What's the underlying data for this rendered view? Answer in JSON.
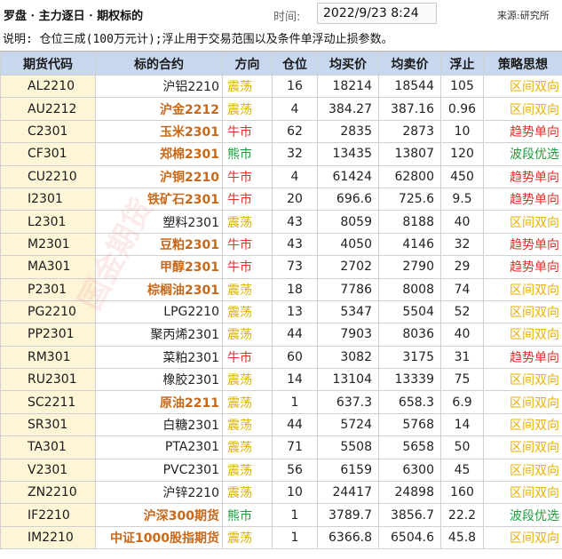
{
  "header": {
    "title": "罗盘 · 主力逐日 · 期权标的",
    "time_label": "时间:",
    "time_value": "2022/9/23 8:24",
    "source": "来源:研究所"
  },
  "note": "说明: 仓位三成(100万元计);浮止用于交易范围以及条件单浮动止损参数。",
  "watermark": "国金期货",
  "colors": {
    "header_bg": "#c7d7ee",
    "code_bg": "#fdf5d6",
    "highlight_name": "#c7691b",
    "dir_oscillation": "#d9b300",
    "dir_bull": "#e0302a",
    "dir_bear": "#1a9e3c",
    "strat_range": "#e8b000",
    "strat_trend": "#e0302a",
    "strat_wave": "#1a9e3c"
  },
  "columns": [
    "期货代码",
    "标的合约",
    "方向",
    "仓位",
    "均买价",
    "均卖价",
    "浮止",
    "策略思想"
  ],
  "rows": [
    {
      "code": "AL2210",
      "name": "沪铝2210",
      "hl": false,
      "dir": "震荡",
      "pos": "16",
      "buy": "18214",
      "sell": "18544",
      "stop": "105",
      "strat": "区间双向"
    },
    {
      "code": "AU2212",
      "name": "沪金2212",
      "hl": true,
      "dir": "震荡",
      "pos": "4",
      "buy": "384.27",
      "sell": "387.16",
      "stop": "0.96",
      "strat": "区间双向"
    },
    {
      "code": "C2301",
      "name": "玉米2301",
      "hl": true,
      "dir": "牛市",
      "pos": "62",
      "buy": "2835",
      "sell": "2873",
      "stop": "10",
      "strat": "趋势单向"
    },
    {
      "code": "CF301",
      "name": "郑棉2301",
      "hl": true,
      "dir": "熊市",
      "pos": "32",
      "buy": "13435",
      "sell": "13807",
      "stop": "120",
      "strat": "波段优选"
    },
    {
      "code": "CU2210",
      "name": "沪铜2210",
      "hl": true,
      "dir": "牛市",
      "pos": "4",
      "buy": "61424",
      "sell": "62800",
      "stop": "450",
      "strat": "趋势单向"
    },
    {
      "code": "I2301",
      "name": "铁矿石2301",
      "hl": true,
      "dir": "牛市",
      "pos": "20",
      "buy": "696.6",
      "sell": "725.6",
      "stop": "9.5",
      "strat": "趋势单向"
    },
    {
      "code": "L2301",
      "name": "塑料2301",
      "hl": false,
      "dir": "震荡",
      "pos": "43",
      "buy": "8059",
      "sell": "8188",
      "stop": "40",
      "strat": "区间双向"
    },
    {
      "code": "M2301",
      "name": "豆粕2301",
      "hl": true,
      "dir": "牛市",
      "pos": "43",
      "buy": "4050",
      "sell": "4146",
      "stop": "32",
      "strat": "趋势单向"
    },
    {
      "code": "MA301",
      "name": "甲醇2301",
      "hl": true,
      "dir": "牛市",
      "pos": "73",
      "buy": "2702",
      "sell": "2790",
      "stop": "29",
      "strat": "趋势单向"
    },
    {
      "code": "P2301",
      "name": "棕榈油2301",
      "hl": true,
      "dir": "震荡",
      "pos": "18",
      "buy": "7786",
      "sell": "8008",
      "stop": "74",
      "strat": "区间双向"
    },
    {
      "code": "PG2210",
      "name": "LPG2210",
      "hl": false,
      "dir": "震荡",
      "pos": "13",
      "buy": "5347",
      "sell": "5504",
      "stop": "52",
      "strat": "区间双向"
    },
    {
      "code": "PP2301",
      "name": "聚丙烯2301",
      "hl": false,
      "dir": "震荡",
      "pos": "44",
      "buy": "7903",
      "sell": "8036",
      "stop": "40",
      "strat": "区间双向"
    },
    {
      "code": "RM301",
      "name": "菜粕2301",
      "hl": false,
      "dir": "牛市",
      "pos": "60",
      "buy": "3082",
      "sell": "3175",
      "stop": "31",
      "strat": "趋势单向"
    },
    {
      "code": "RU2301",
      "name": "橡胶2301",
      "hl": false,
      "dir": "震荡",
      "pos": "14",
      "buy": "13104",
      "sell": "13339",
      "stop": "75",
      "strat": "区间双向"
    },
    {
      "code": "SC2211",
      "name": "原油2211",
      "hl": true,
      "dir": "震荡",
      "pos": "1",
      "buy": "637.3",
      "sell": "658.3",
      "stop": "6.9",
      "strat": "区间双向"
    },
    {
      "code": "SR301",
      "name": "白糖2301",
      "hl": false,
      "dir": "震荡",
      "pos": "44",
      "buy": "5724",
      "sell": "5768",
      "stop": "14",
      "strat": "区间双向"
    },
    {
      "code": "TA301",
      "name": "PTA2301",
      "hl": false,
      "dir": "震荡",
      "pos": "71",
      "buy": "5508",
      "sell": "5658",
      "stop": "50",
      "strat": "区间双向"
    },
    {
      "code": "V2301",
      "name": "PVC2301",
      "hl": false,
      "dir": "震荡",
      "pos": "56",
      "buy": "6159",
      "sell": "6300",
      "stop": "45",
      "strat": "区间双向"
    },
    {
      "code": "ZN2210",
      "name": "沪锌2210",
      "hl": false,
      "dir": "震荡",
      "pos": "10",
      "buy": "24417",
      "sell": "24898",
      "stop": "160",
      "strat": "区间双向"
    },
    {
      "code": "IF2210",
      "name": "沪深300期货",
      "hl": true,
      "dir": "熊市",
      "pos": "1",
      "buy": "3789.7",
      "sell": "3856.7",
      "stop": "22.2",
      "strat": "波段优选"
    },
    {
      "code": "IM2210",
      "name": "中证1000股指期货",
      "hl": true,
      "dir": "震荡",
      "pos": "1",
      "buy": "6366.8",
      "sell": "6504.6",
      "stop": "45.8",
      "strat": "区间双向"
    }
  ]
}
